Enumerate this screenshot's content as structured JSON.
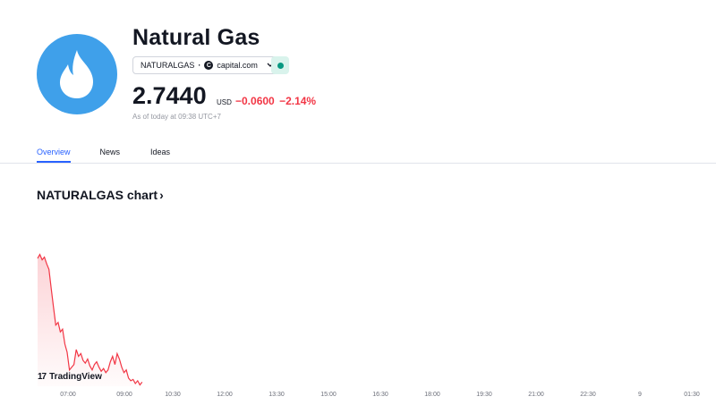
{
  "header": {
    "title": "Natural Gas",
    "logo_icon": "flame-icon",
    "logo_color": "#3fa0ea",
    "symbol": "NATURALGAS",
    "separator": "·",
    "broker": "capital.com",
    "broker_icon": "C",
    "market_status_color": "#089981"
  },
  "quote": {
    "price": "2.7440",
    "currency": "USD",
    "change": "−0.0600",
    "change_percent": "−2.14%",
    "as_of": "As of today at 09:38 UTC+7"
  },
  "tabs": [
    {
      "label": "Overview",
      "active": true
    },
    {
      "label": "News",
      "active": false
    },
    {
      "label": "Ideas",
      "active": false
    }
  ],
  "chart_section": {
    "heading": "NATURALGAS chart",
    "heading_arrow": "›"
  },
  "tradingview_label": "TradingView",
  "tradingview_mark": "17",
  "chart_data": {
    "type": "area",
    "line_color": "#f23645",
    "x_ticks": [
      "07:00",
      "09:00",
      "10:30",
      "12:00",
      "13:30",
      "15:00",
      "16:30",
      "18:00",
      "19:30",
      "21:00",
      "22:30",
      "9",
      "01:30"
    ],
    "points": [
      [
        0.0,
        0.94
      ],
      [
        0.1,
        0.97
      ],
      [
        0.2,
        0.93
      ],
      [
        0.3,
        0.95
      ],
      [
        0.4,
        0.9
      ],
      [
        0.5,
        0.86
      ],
      [
        0.6,
        0.72
      ],
      [
        0.7,
        0.58
      ],
      [
        0.8,
        0.45
      ],
      [
        0.9,
        0.47
      ],
      [
        1.0,
        0.4
      ],
      [
        1.1,
        0.42
      ],
      [
        1.2,
        0.31
      ],
      [
        1.3,
        0.25
      ],
      [
        1.4,
        0.12
      ],
      [
        1.5,
        0.14
      ],
      [
        1.6,
        0.16
      ],
      [
        1.7,
        0.27
      ],
      [
        1.8,
        0.22
      ],
      [
        1.9,
        0.24
      ],
      [
        2.0,
        0.19
      ],
      [
        2.1,
        0.17
      ],
      [
        2.2,
        0.2
      ],
      [
        2.3,
        0.15
      ],
      [
        2.4,
        0.12
      ],
      [
        2.5,
        0.16
      ],
      [
        2.6,
        0.18
      ],
      [
        2.7,
        0.14
      ],
      [
        2.8,
        0.11
      ],
      [
        2.9,
        0.13
      ],
      [
        3.0,
        0.1
      ],
      [
        3.1,
        0.12
      ],
      [
        3.2,
        0.18
      ],
      [
        3.3,
        0.22
      ],
      [
        3.4,
        0.16
      ],
      [
        3.5,
        0.24
      ],
      [
        3.6,
        0.2
      ],
      [
        3.7,
        0.14
      ],
      [
        3.8,
        0.1
      ],
      [
        3.9,
        0.12
      ],
      [
        4.0,
        0.06
      ],
      [
        4.1,
        0.04
      ],
      [
        4.2,
        0.05
      ],
      [
        4.3,
        0.02
      ],
      [
        4.4,
        0.04
      ],
      [
        4.5,
        0.01
      ],
      [
        4.6,
        0.03
      ]
    ],
    "y_range": [
      0,
      1
    ]
  }
}
